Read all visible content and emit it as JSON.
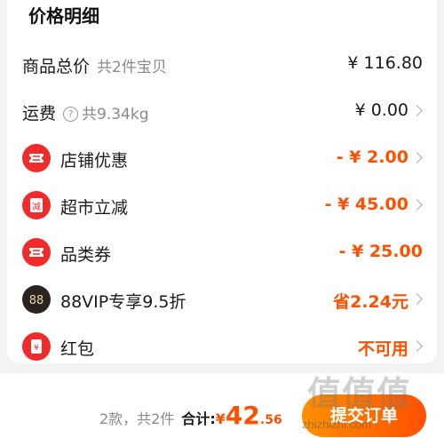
{
  "price_detail": {
    "title": "价格明细",
    "rows": [
      {
        "label": "商品总价",
        "sub": "共2件宝贝",
        "amount": "¥ 116.80",
        "chevron": false
      },
      {
        "label": "运费",
        "sub": "共9.34kg",
        "help_icon": "question-circle-icon",
        "amount": "¥ 0.00",
        "chevron": true
      },
      {
        "label": "店铺优惠",
        "icon": "ticket-icon",
        "amount": "- ¥ 2.00",
        "chevron": true
      },
      {
        "label": "超市立减",
        "icon": "reduce-badge-icon",
        "icon_text": "减",
        "amount": "- ¥ 45.00",
        "chevron": true
      },
      {
        "label": "品类券",
        "icon": "ticket-icon",
        "amount": "- ¥ 25.00",
        "chevron": false
      },
      {
        "label": "88VIP专享9.5折",
        "icon": "vip88-icon",
        "icon_text": "88",
        "amount": "省2.24元",
        "chevron": true
      },
      {
        "label": "红包",
        "icon": "red-envelope-icon",
        "icon_text": "¥",
        "amount": "不可用",
        "chevron": true
      }
    ]
  },
  "footer": {
    "count_text": "2款，共2件",
    "total_label": "合计:",
    "currency": "¥",
    "total_int": "42",
    "total_dec": ".56",
    "submit_label": "提交订单"
  },
  "watermark": {
    "text": "值值值",
    "site": "zhizhizhi.com"
  },
  "colors": {
    "accent": "#ff5000",
    "icon_red": "#f12b2b",
    "vip_dark": "#2b2320"
  }
}
